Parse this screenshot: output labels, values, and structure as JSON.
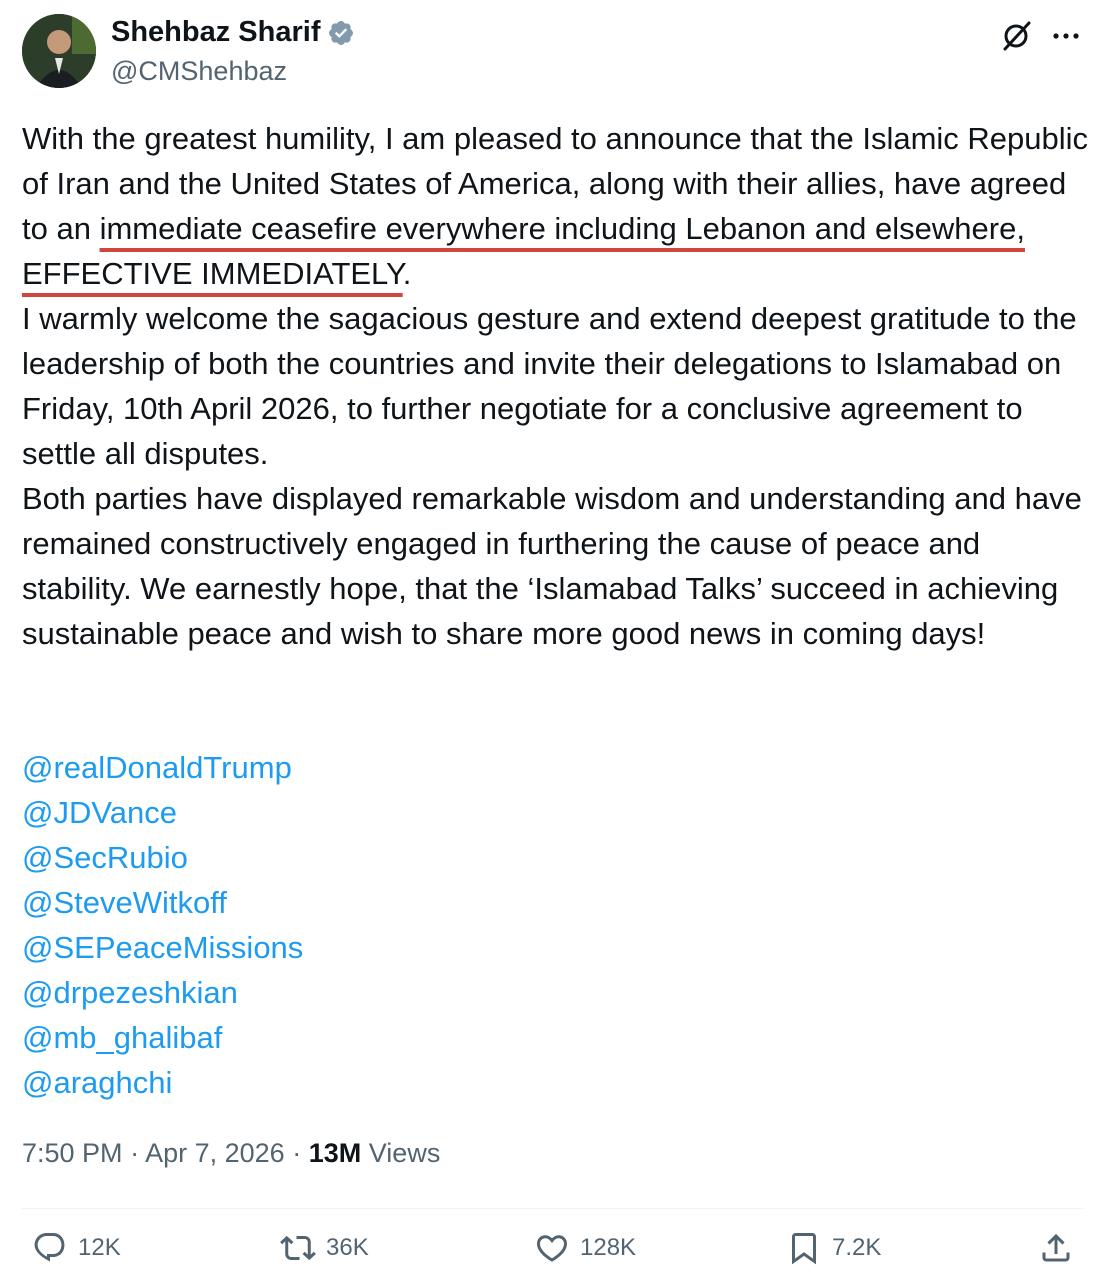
{
  "author": {
    "name": "Shehbaz Sharif",
    "handle": "@CMShehbaz",
    "avatar_icon": "profile-photo",
    "verified_color": "#829aab"
  },
  "post": {
    "paragraph1_before": "With the greatest humility, I am pleased to announce that the Islamic Republic of Iran and the United States of America, along with their allies, have agreed to an ",
    "paragraph1_highlight": "immediate ceasefire everywhere including Lebanon and elsewhere, EFFECTIVE IMMEDIATELY",
    "paragraph1_after": ".",
    "paragraph2": "I warmly welcome the sagacious gesture and extend deepest gratitude to the leadership of both the countries and invite their delegations to Islamabad on Friday, 10th April 2026, to further negotiate for a conclusive agreement to settle all disputes.",
    "paragraph3": "Both parties have displayed remarkable wisdom and understanding and have remained constructively engaged in furthering the cause of peace and stability. We earnestly hope, that the ‘Islamabad Talks’ succeed in achieving sustainable peace and wish to share more good news in coming days!",
    "highlight_color": "#d0453c",
    "mentions": [
      "@realDonaldTrump",
      "@JDVance",
      "@SecRubio",
      "@SteveWitkoff",
      "@SEPeaceMissions",
      "@drpezeshkian",
      "@mb_ghalibaf",
      "@araghchi"
    ],
    "mention_color": "#1d9bf0"
  },
  "meta": {
    "time": "7:50 PM",
    "separator": "·",
    "date": "Apr 7, 2026",
    "views_count": "13M",
    "views_label": "Views"
  },
  "actions": {
    "replies": "12K",
    "reposts": "36K",
    "likes": "128K",
    "bookmarks": "7.2K"
  }
}
